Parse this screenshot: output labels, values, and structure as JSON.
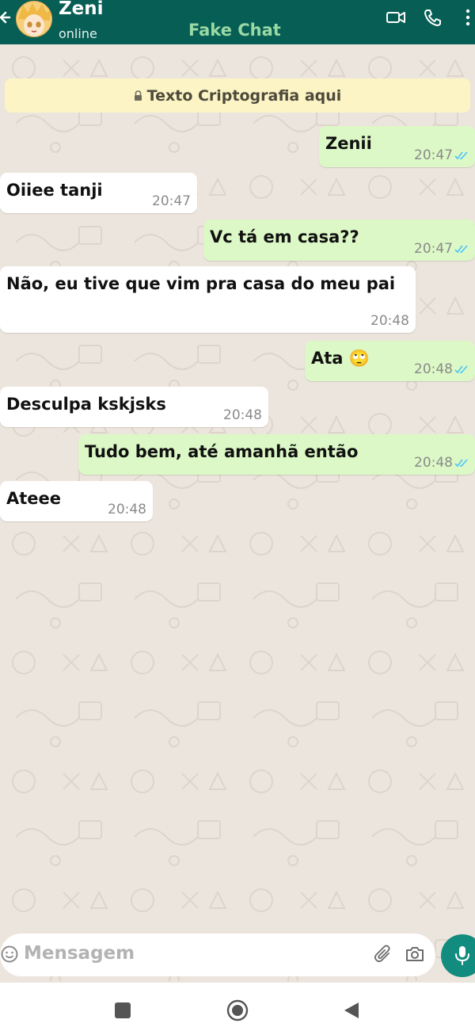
{
  "header": {
    "contact_name": "Zeni",
    "status": "online",
    "app_title": "Fake Chat"
  },
  "banner": {
    "text": "Texto Criptografia aqui"
  },
  "messages": [
    {
      "direction": "out",
      "text": "Zenii",
      "time": "20:47",
      "ticks": "read"
    },
    {
      "direction": "in",
      "text": "Oiiee tanji",
      "time": "20:47"
    },
    {
      "direction": "out",
      "text": "Vc tá em casa??",
      "time": "20:47",
      "ticks": "read"
    },
    {
      "direction": "in",
      "text": "Não, eu tive que vim pra casa do meu pai",
      "time": "20:48"
    },
    {
      "direction": "out",
      "text": "Ata 🙄",
      "time": "20:48",
      "ticks": "read"
    },
    {
      "direction": "in",
      "text": "Desculpa kskjsks",
      "time": "20:48"
    },
    {
      "direction": "out",
      "text": "Tudo bem, até amanhã então",
      "time": "20:48",
      "ticks": "read"
    },
    {
      "direction": "in",
      "text": "Ateee",
      "time": "20:48"
    }
  ],
  "input": {
    "placeholder": "Mensagem"
  },
  "colors": {
    "header": "#075e54",
    "outgoing_bubble": "#dcf8c6",
    "incoming_bubble": "#ffffff",
    "read_ticks": "#4fc3f7",
    "mic_button": "#128c7e"
  },
  "icons": [
    "back-arrow-icon",
    "video-call-icon",
    "phone-icon",
    "more-vert-icon",
    "lock-icon",
    "emoji-icon",
    "attach-icon",
    "camera-icon",
    "mic-icon"
  ]
}
